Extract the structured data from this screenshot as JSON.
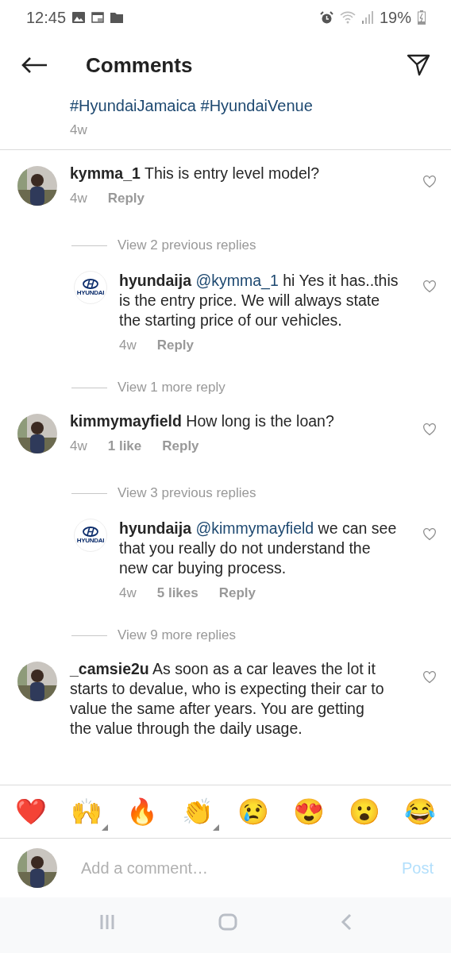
{
  "status_bar": {
    "time": "12:45",
    "battery": "19%"
  },
  "header": {
    "title": "Comments"
  },
  "caption": {
    "text": "#HyundaiJamaica #HyundaiVenue",
    "time": "4w"
  },
  "items": [
    {
      "kind": "comment",
      "username": "kymma_1",
      "text": "This is entry level model?",
      "time": "4w",
      "reply": "Reply"
    },
    {
      "kind": "view_replies",
      "label": "View 2 previous replies"
    },
    {
      "kind": "reply",
      "brand": "HYUNDAI",
      "username": "hyundaija",
      "mention": "@kymma_1",
      "text": "hi Yes it has..this is the entry price. We will always state the starting price of our vehicles.",
      "time": "4w",
      "reply": "Reply"
    },
    {
      "kind": "view_replies",
      "label": "View 1 more reply"
    },
    {
      "kind": "comment",
      "username": "kimmymayfield",
      "text": "How long is the loan?",
      "time": "4w",
      "likes": "1 like",
      "reply": "Reply"
    },
    {
      "kind": "view_replies",
      "label": "View 3 previous replies"
    },
    {
      "kind": "reply",
      "brand": "HYUNDAI",
      "username": "hyundaija",
      "mention": "@kimmymayfield",
      "text": "we can see that you really do not understand the new car buying process.",
      "time": "4w",
      "likes": "5 likes",
      "reply": "Reply"
    },
    {
      "kind": "view_replies",
      "label": "View 9 more replies"
    },
    {
      "kind": "comment",
      "username": "_camsie2u",
      "text": "As soon as a car leaves the lot it starts to devalue, who is expecting their car to value the same after years. You are getting the value through the daily usage."
    }
  ],
  "reactions": [
    {
      "emoji": "❤️",
      "has_variants": false
    },
    {
      "emoji": "🙌",
      "has_variants": true
    },
    {
      "emoji": "🔥",
      "has_variants": false
    },
    {
      "emoji": "👏",
      "has_variants": true
    },
    {
      "emoji": "😢",
      "has_variants": false
    },
    {
      "emoji": "😍",
      "has_variants": false
    },
    {
      "emoji": "😮",
      "has_variants": false
    },
    {
      "emoji": "😂",
      "has_variants": false
    }
  ],
  "composer": {
    "placeholder": "Add a comment…",
    "post": "Post"
  }
}
